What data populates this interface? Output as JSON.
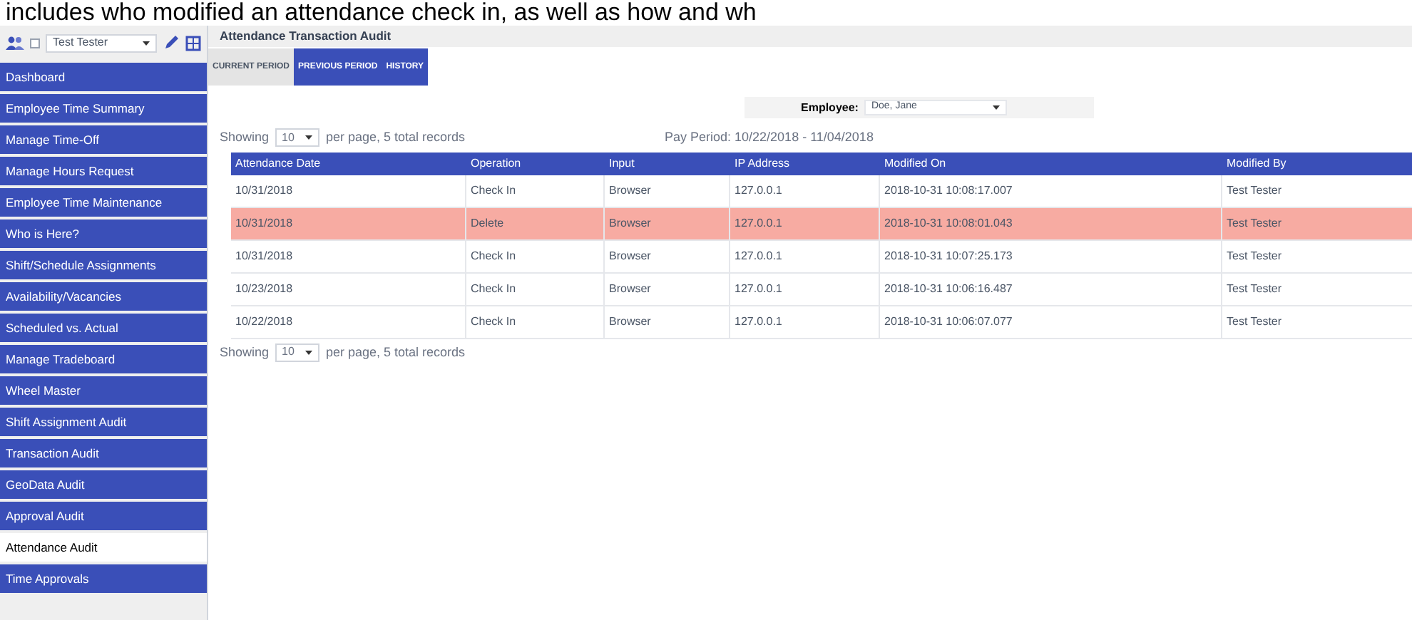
{
  "caption": "includes who modified an attendance check in, as well as how and wh",
  "user_select": {
    "checked": false,
    "value": "Test Tester"
  },
  "sidebar": {
    "items": [
      {
        "label": "Dashboard",
        "selected": false
      },
      {
        "label": "Employee Time Summary",
        "selected": false
      },
      {
        "label": "Manage Time-Off",
        "selected": false
      },
      {
        "label": "Manage Hours Request",
        "selected": false
      },
      {
        "label": "Employee Time Maintenance",
        "selected": false
      },
      {
        "label": "Who is Here?",
        "selected": false
      },
      {
        "label": "Shift/Schedule Assignments",
        "selected": false
      },
      {
        "label": "Availability/Vacancies",
        "selected": false
      },
      {
        "label": "Scheduled vs. Actual",
        "selected": false
      },
      {
        "label": "Manage Tradeboard",
        "selected": false
      },
      {
        "label": "Wheel Master",
        "selected": false
      },
      {
        "label": "Shift Assignment Audit",
        "selected": false
      },
      {
        "label": "Transaction Audit",
        "selected": false
      },
      {
        "label": "GeoData Audit",
        "selected": false
      },
      {
        "label": "Approval Audit",
        "selected": false
      },
      {
        "label": "Attendance Audit",
        "selected": true
      },
      {
        "label": "Time Approvals",
        "selected": false
      }
    ]
  },
  "page_title": "Attendance Transaction Audit",
  "tabs": [
    {
      "label": "CURRENT PERIOD",
      "selected": false
    },
    {
      "label": "PREVIOUS PERIOD",
      "selected": true
    },
    {
      "label": "HISTORY",
      "selected": true
    }
  ],
  "employee": {
    "label": "Employee:",
    "value": "Doe, Jane"
  },
  "pager_top": {
    "prefix": "Showing",
    "value": "10",
    "suffix": "per page, 5 total records"
  },
  "pay_period": "Pay Period: 10/22/2018 - 11/04/2018",
  "table": {
    "columns": [
      "Attendance Date",
      "Operation",
      "Input",
      "IP Address",
      "Modified On",
      "Modified By"
    ],
    "rows": [
      {
        "cells": [
          "10/31/2018",
          "Check In",
          "Browser",
          "127.0.0.1",
          "2018-10-31 10:08:17.007",
          "Test Tester"
        ],
        "selected": false
      },
      {
        "cells": [
          "10/31/2018",
          "Delete",
          "Browser",
          "127.0.0.1",
          "2018-10-31 10:08:01.043",
          "Test Tester"
        ],
        "selected": true
      },
      {
        "cells": [
          "10/31/2018",
          "Check In",
          "Browser",
          "127.0.0.1",
          "2018-10-31 10:07:25.173",
          "Test Tester"
        ],
        "selected": false
      },
      {
        "cells": [
          "10/23/2018",
          "Check In",
          "Browser",
          "127.0.0.1",
          "2018-10-31 10:06:16.487",
          "Test Tester"
        ],
        "selected": false
      },
      {
        "cells": [
          "10/22/2018",
          "Check In",
          "Browser",
          "127.0.0.1",
          "2018-10-31 10:06:07.077",
          "Test Tester"
        ],
        "selected": false
      }
    ]
  },
  "pager_bottom": {
    "prefix": "Showing",
    "value": "10",
    "suffix": "per page, 5 total records"
  }
}
